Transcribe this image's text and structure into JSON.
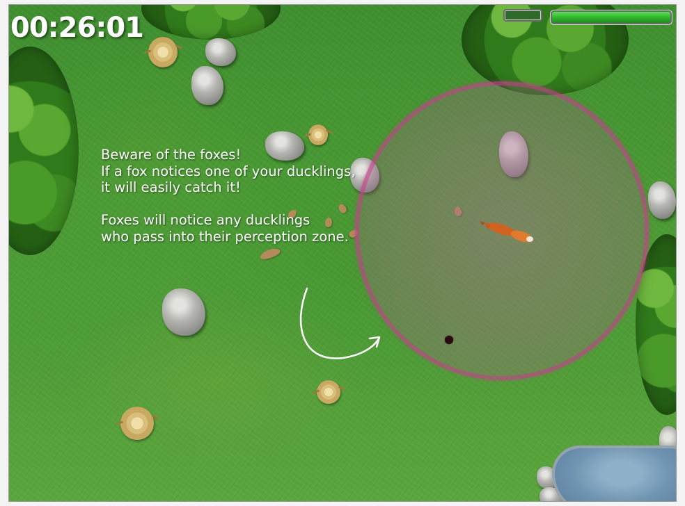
{
  "hud": {
    "timer": "00:26:01",
    "health_level": 1.0,
    "colors": {
      "health": "#2fb62c",
      "perception_zone": "#c83c8c"
    }
  },
  "tutorial": {
    "lines": [
      "Beware of the foxes!",
      "If a fox notices one of your ducklings,",
      "it will easily catch it!",
      "",
      "Foxes will notice any ducklings",
      "who pass into their perception zone."
    ]
  },
  "scene": {
    "icons": [
      "tree-icon",
      "rock-icon",
      "stump-icon",
      "leaf-icon",
      "pond-icon",
      "fox-icon",
      "duckling-icon",
      "arrow-icon"
    ]
  }
}
